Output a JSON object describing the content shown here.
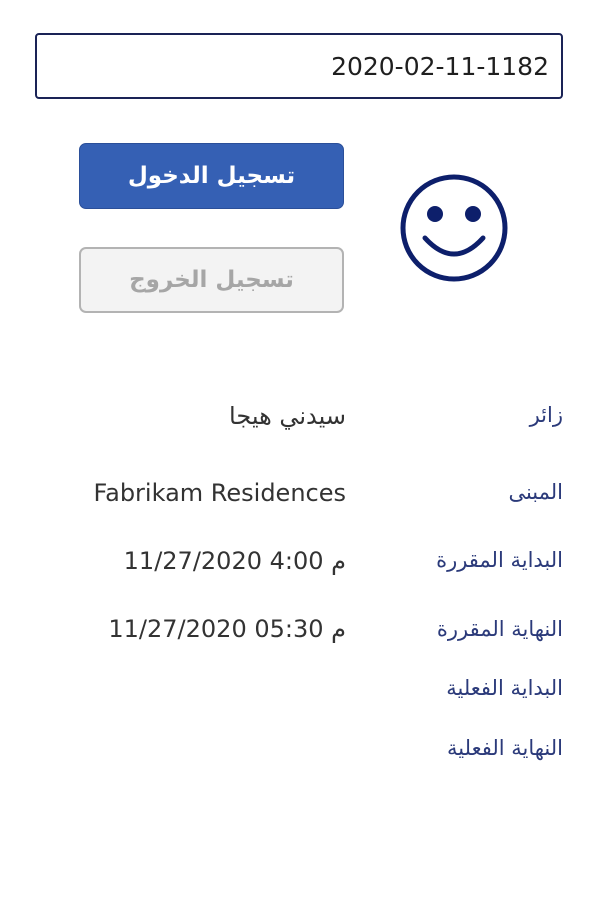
{
  "visit_id": "2020-02-11-1182",
  "buttons": {
    "check_in": "تسجيل الدخول",
    "check_out": "تسجيل الخروج"
  },
  "status_icon": "smiley-face-icon",
  "colors": {
    "primary_button": "#3560b4",
    "label_text": "#2b3a7a",
    "icon": "#0d1f6b",
    "disabled_button_bg": "#f3f3f3"
  },
  "details": {
    "visitor_label": "زائر",
    "visitor_value": "سيدني هيجا",
    "building_label": "المبنى",
    "building_value": "Fabrikam Residences",
    "planned_start_label": "البداية المقررة",
    "planned_start_value": "11/27/2020 4:00 م",
    "planned_end_label": "النهاية المقررة",
    "planned_end_value": "11/27/2020 05:30 م",
    "actual_start_label": "البداية الفعلية",
    "actual_end_label": "النهاية الفعلية"
  }
}
